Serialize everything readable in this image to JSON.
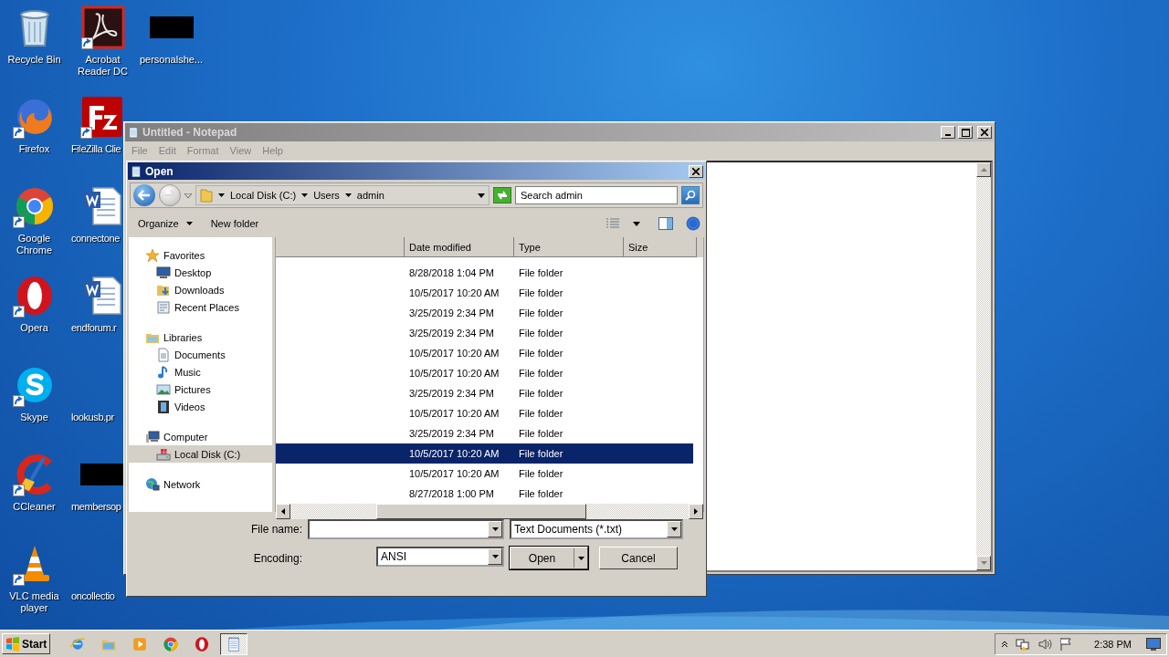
{
  "desktop_icons": [
    {
      "label": "Recycle Bin",
      "kind": "recycle",
      "shortcut": false
    },
    {
      "label": "Firefox",
      "kind": "firefox",
      "shortcut": true
    },
    {
      "label": "Google Chrome",
      "kind": "chrome",
      "shortcut": true
    },
    {
      "label": "Opera",
      "kind": "opera",
      "shortcut": true
    },
    {
      "label": "Skype",
      "kind": "skype",
      "shortcut": true
    },
    {
      "label": "CCleaner",
      "kind": "ccleaner",
      "shortcut": true
    },
    {
      "label": "VLC media player",
      "kind": "vlc",
      "shortcut": true
    },
    {
      "label": "Acrobat Reader DC",
      "kind": "acrobat",
      "shortcut": true
    },
    {
      "label": "FileZilla Clie",
      "kind": "filezilla",
      "shortcut": true
    },
    {
      "label": "connectone",
      "kind": "word",
      "shortcut": false
    },
    {
      "label": "endforum.r",
      "kind": "word",
      "shortcut": false
    },
    {
      "label": "lookusb.pr",
      "kind": "blank",
      "shortcut": false
    },
    {
      "label": "membersop",
      "kind": "redacted",
      "shortcut": false
    },
    {
      "label": "oncollectio",
      "kind": "blank",
      "shortcut": false
    },
    {
      "label": "personalshe...",
      "kind": "redacted",
      "shortcut": false
    }
  ],
  "notepad": {
    "title": "Untitled - Notepad",
    "menu": [
      "File",
      "Edit",
      "Format",
      "View",
      "Help"
    ]
  },
  "open_dialog": {
    "title": "Open",
    "breadcrumb": [
      "Local Disk (C:)",
      "Users",
      "admin"
    ],
    "search": {
      "placeholder": "Search admin"
    },
    "toolbar": {
      "organize": "Organize",
      "new_folder": "New folder"
    },
    "navigation": [
      {
        "label": "Favorites",
        "kind": "star",
        "selected": false,
        "children": [
          {
            "label": "Desktop",
            "kind": "desktop",
            "selected": false
          },
          {
            "label": "Downloads",
            "kind": "downloads",
            "selected": false
          },
          {
            "label": "Recent Places",
            "kind": "recent",
            "selected": false
          }
        ]
      },
      {
        "label": "Libraries",
        "kind": "libraries",
        "selected": false,
        "children": [
          {
            "label": "Documents",
            "kind": "documents",
            "selected": false
          },
          {
            "label": "Music",
            "kind": "music",
            "selected": false
          },
          {
            "label": "Pictures",
            "kind": "pictures",
            "selected": false
          },
          {
            "label": "Videos",
            "kind": "videos",
            "selected": false
          }
        ]
      },
      {
        "label": "Computer",
        "kind": "computer",
        "selected": false,
        "children": [
          {
            "label": "Local Disk (C:)",
            "kind": "disk",
            "selected": true
          }
        ]
      },
      {
        "label": "Network",
        "kind": "network",
        "selected": false
      }
    ],
    "file_list": {
      "columns": [
        "Date modified",
        "Type",
        "Size"
      ],
      "rows": [
        {
          "date": "8/28/2018 1:04 PM",
          "type": "File folder",
          "selected": false
        },
        {
          "date": "10/5/2017 10:20 AM",
          "type": "File folder",
          "selected": false
        },
        {
          "date": "3/25/2019 2:34 PM",
          "type": "File folder",
          "selected": false
        },
        {
          "date": "3/25/2019 2:34 PM",
          "type": "File folder",
          "selected": false
        },
        {
          "date": "10/5/2017 10:20 AM",
          "type": "File folder",
          "selected": false
        },
        {
          "date": "10/5/2017 10:20 AM",
          "type": "File folder",
          "selected": false
        },
        {
          "date": "3/25/2019 2:34 PM",
          "type": "File folder",
          "selected": false
        },
        {
          "date": "10/5/2017 10:20 AM",
          "type": "File folder",
          "selected": false
        },
        {
          "date": "3/25/2019 2:34 PM",
          "type": "File folder",
          "selected": false
        },
        {
          "date": "10/5/2017 10:20 AM",
          "type": "File folder",
          "selected": true
        },
        {
          "date": "10/5/2017 10:20 AM",
          "type": "File folder",
          "selected": false
        },
        {
          "date": "8/27/2018 1:00 PM",
          "type": "File folder",
          "selected": false
        }
      ]
    },
    "file_name_label": "File name:",
    "file_type": "Text Documents (*.txt)",
    "encoding_label": "Encoding:",
    "encoding": "ANSI",
    "buttons": {
      "open": "Open",
      "cancel": "Cancel"
    }
  },
  "taskbar": {
    "start": "Start",
    "apps": [
      {
        "kind": "ie",
        "active": false
      },
      {
        "kind": "explorer",
        "active": false
      },
      {
        "kind": "media",
        "active": false
      },
      {
        "kind": "chrome",
        "active": false
      },
      {
        "kind": "opera",
        "active": false
      },
      {
        "kind": "notepad",
        "active": true
      }
    ],
    "clock": "2:38 PM"
  }
}
